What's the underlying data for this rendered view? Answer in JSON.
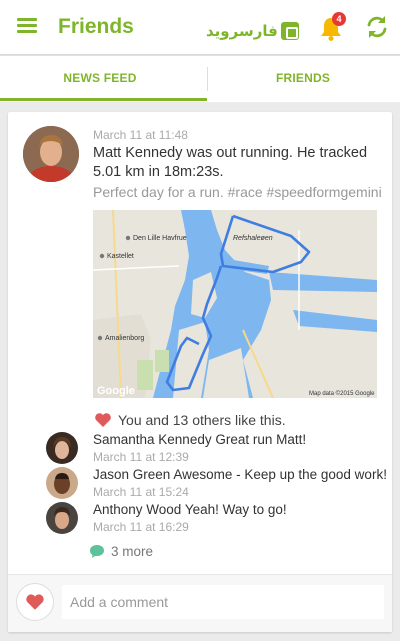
{
  "app": {
    "title": "Friends",
    "brand_logo_text": "فارسروید",
    "notification_count": "4",
    "accent_color": "#7fb52b"
  },
  "tabs": [
    {
      "label": "NEWS FEED",
      "active": true
    },
    {
      "label": "FRIENDS",
      "active": false
    }
  ],
  "post": {
    "time": "March 11 at 11:48",
    "author": "Matt Kennedy",
    "text": " was out running. He tracked 5.01 km in 18m:23s.",
    "tags": "Perfect day for a run. #race #speedformgemini",
    "map": {
      "labels": {
        "refshalepen": "Refshaleøen",
        "den_lille_havfrue": "Den Lille Havfrue",
        "kastellet": "Kastellet",
        "amalienborg": "Amalienborg",
        "logo": "Google",
        "credit": "Map data ©2015 Google"
      }
    },
    "likes": "You and 13 others like this."
  },
  "comments": [
    {
      "name": "Samantha Kennedy",
      "text": "Great run Matt!",
      "time": "March 11 at 12:39"
    },
    {
      "name": "Jason Green",
      "text": "Awesome - Keep up the good work!",
      "time": "March 11 at 15:24"
    },
    {
      "name": "Anthony Wood",
      "text": "Yeah! Way to go!",
      "time": "March 11 at 16:29"
    }
  ],
  "more_comments": "3 more",
  "add_comment_placeholder": "Add a comment"
}
